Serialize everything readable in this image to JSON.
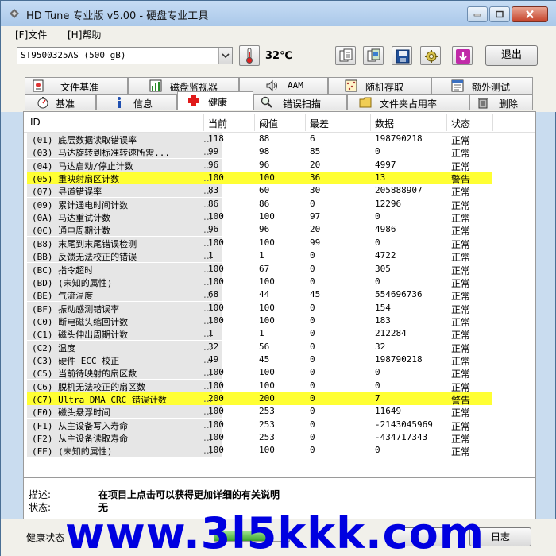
{
  "window": {
    "title": "HD Tune 专业版 v5.00 - 硬盘专业工具",
    "controls": [
      "minimize",
      "maximize",
      "close"
    ]
  },
  "menu": {
    "file": "[F]文件",
    "help": "[H]帮助"
  },
  "toolbar": {
    "drive": "ST9500325AS  (500 gB)",
    "temperature": "32℃",
    "exit_label": "退出",
    "icons": [
      "copy-info-icon",
      "copy-screen-icon",
      "save-icon",
      "options-icon",
      "download-icon"
    ]
  },
  "tabs_top": [
    {
      "label": "文件基准",
      "icon": "file-benchmark-icon"
    },
    {
      "label": "磁盘监视器",
      "icon": "disk-monitor-icon"
    },
    {
      "label": "AAM",
      "icon": "speaker-icon"
    },
    {
      "label": "随机存取",
      "icon": "random-access-icon"
    },
    {
      "label": "额外测试",
      "icon": "extra-tests-icon"
    }
  ],
  "tabs_bottom": [
    {
      "label": "基准",
      "icon": "benchmark-icon"
    },
    {
      "label": "信息",
      "icon": "info-icon"
    },
    {
      "label": "健康",
      "icon": "health-cross-icon",
      "active": true
    },
    {
      "label": "错误扫描",
      "icon": "error-scan-icon"
    },
    {
      "label": "文件夹占用率",
      "icon": "folder-icon"
    },
    {
      "label": "删除",
      "icon": "trash-icon"
    }
  ],
  "table": {
    "headers": [
      "ID",
      "当前",
      "阈值",
      "最差",
      "数据",
      "状态"
    ],
    "rows": [
      {
        "id": "(01) 底层数据读取错误率",
        "cur": "118",
        "thr": "88",
        "worst": "6",
        "data": "198790218",
        "status": "正常"
      },
      {
        "id": "(03) 马达旋转到标准转速所需...",
        "cur": "99",
        "thr": "98",
        "worst": "85",
        "data": "0",
        "status": "正常"
      },
      {
        "id": "(04) 马达启动/停止计数",
        "cur": "96",
        "thr": "96",
        "worst": "20",
        "data": "4997",
        "status": "正常"
      },
      {
        "id": "(05) 重映射扇区计数",
        "cur": "100",
        "thr": "100",
        "worst": "36",
        "data": "13",
        "status": "警告",
        "warn": true
      },
      {
        "id": "(07) 寻道错误率",
        "cur": "83",
        "thr": "60",
        "worst": "30",
        "data": "205888907",
        "status": "正常"
      },
      {
        "id": "(09) 累计通电时间计数",
        "cur": "86",
        "thr": "86",
        "worst": "0",
        "data": "12296",
        "status": "正常"
      },
      {
        "id": "(0A) 马达重试计数",
        "cur": "100",
        "thr": "100",
        "worst": "97",
        "data": "0",
        "status": "正常"
      },
      {
        "id": "(0C) 通电周期计数",
        "cur": "96",
        "thr": "96",
        "worst": "20",
        "data": "4986",
        "status": "正常"
      },
      {
        "id": "(B8) 末尾到末尾错误检测",
        "cur": "100",
        "thr": "100",
        "worst": "99",
        "data": "0",
        "status": "正常"
      },
      {
        "id": "(BB) 反馈无法校正的错误",
        "cur": "1",
        "thr": "1",
        "worst": "0",
        "data": "4722",
        "status": "正常"
      },
      {
        "id": "(BC) 指令超时",
        "cur": "100",
        "thr": "67",
        "worst": "0",
        "data": "305",
        "status": "正常"
      },
      {
        "id": "(BD) (未知的属性)",
        "cur": "100",
        "thr": "100",
        "worst": "0",
        "data": "0",
        "status": "正常"
      },
      {
        "id": "(BE) 气流温度",
        "cur": "68",
        "thr": "44",
        "worst": "45",
        "data": "554696736",
        "status": "正常"
      },
      {
        "id": "(BF) 振动感测错误率",
        "cur": "100",
        "thr": "100",
        "worst": "0",
        "data": "154",
        "status": "正常"
      },
      {
        "id": "(C0) 断电磁头缩回计数",
        "cur": "100",
        "thr": "100",
        "worst": "0",
        "data": "183",
        "status": "正常"
      },
      {
        "id": "(C1) 磁头伸出周期计数",
        "cur": "1",
        "thr": "1",
        "worst": "0",
        "data": "212284",
        "status": "正常"
      },
      {
        "id": "(C2) 温度",
        "cur": "32",
        "thr": "56",
        "worst": "0",
        "data": "32",
        "status": "正常"
      },
      {
        "id": "(C3) 硬件 ECC 校正",
        "cur": "49",
        "thr": "45",
        "worst": "0",
        "data": "198790218",
        "status": "正常"
      },
      {
        "id": "(C5) 当前待映射的扇区数",
        "cur": "100",
        "thr": "100",
        "worst": "0",
        "data": "0",
        "status": "正常"
      },
      {
        "id": "(C6) 脱机无法校正的扇区数",
        "cur": "100",
        "thr": "100",
        "worst": "0",
        "data": "0",
        "status": "正常"
      },
      {
        "id": "(C7) Ultra DMA CRC 错误计数",
        "cur": "200",
        "thr": "200",
        "worst": "0",
        "data": "7",
        "status": "警告",
        "warn": true
      },
      {
        "id": "(F0) 磁头悬浮时间",
        "cur": "100",
        "thr": "253",
        "worst": "0",
        "data": "11649",
        "status": "正常"
      },
      {
        "id": "(F1) 从主设备写入寿命",
        "cur": "100",
        "thr": "253",
        "worst": "0",
        "data": "-2143045969",
        "status": "正常"
      },
      {
        "id": "(F2) 从主设备读取寿命",
        "cur": "100",
        "thr": "253",
        "worst": "0",
        "data": "-434717343",
        "status": "正常"
      },
      {
        "id": "(FE) (未知的属性)",
        "cur": "100",
        "thr": "100",
        "worst": "0",
        "data": "0",
        "status": "正常"
      }
    ]
  },
  "description": {
    "desc_label": "描述:",
    "desc_text": "在项目上点击可以获得更加详细的有关说明",
    "state_label": "状态:",
    "state_text": "无"
  },
  "statusbar": {
    "health_label": "健康状态",
    "health_level": 0.7,
    "button_1": "",
    "button_2": "日志"
  },
  "watermark": "www.3l5kkk.com",
  "colors": {
    "warn_row": "#ffff33",
    "watermark": "#0000e0"
  }
}
